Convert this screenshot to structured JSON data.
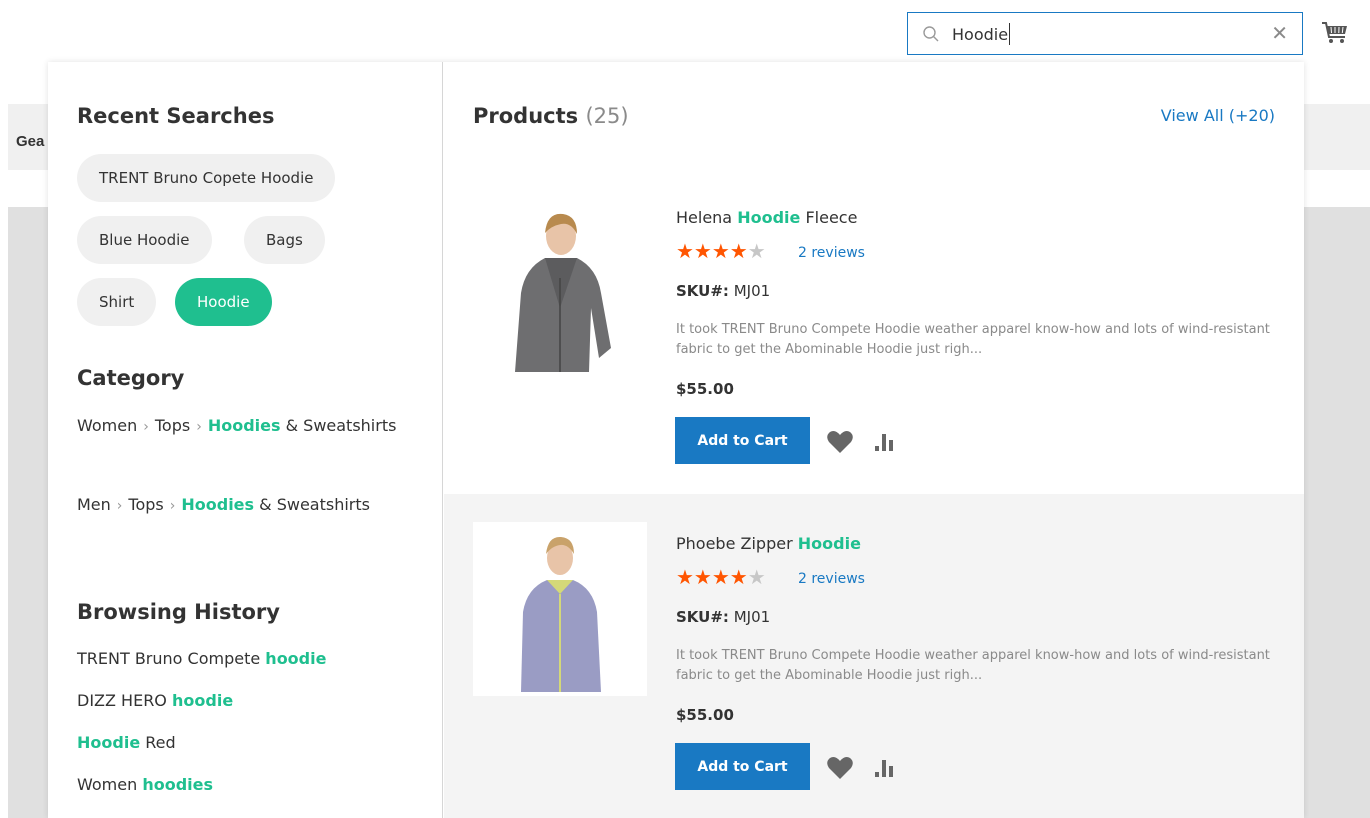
{
  "header": {
    "search": {
      "value": "Hoodie",
      "placeholder": ""
    },
    "icons": {
      "search": "search-icon",
      "clear": "close-icon",
      "cart": "cart-icon"
    }
  },
  "background": {
    "nav_label": "Gea"
  },
  "recent_searches": {
    "title": "Recent Searches",
    "items": [
      {
        "label": "TRENT Bruno Copete Hoodie",
        "active": false
      },
      {
        "label": "Blue Hoodie",
        "active": false
      },
      {
        "label": "Bags",
        "active": false
      },
      {
        "label": "Shirt",
        "active": false
      },
      {
        "label": "Hoodie",
        "active": true
      }
    ]
  },
  "category": {
    "title": "Category",
    "paths": [
      {
        "parts": [
          "Women",
          "Tops"
        ],
        "highlight": "Hoodies",
        "rest": "& Sweatshirts"
      },
      {
        "parts": [
          "Men",
          "Tops"
        ],
        "highlight": "Hoodies",
        "rest": "& Sweatshirts"
      }
    ]
  },
  "browsing_history": {
    "title": "Browsing History",
    "items": [
      {
        "before": "TRENT Bruno Compete",
        "highlight": "hoodie",
        "after": ""
      },
      {
        "before": "DIZZ HERO",
        "highlight": "hoodie",
        "after": ""
      },
      {
        "before": "",
        "highlight": "Hoodie",
        "after": "Red"
      },
      {
        "before": "Women",
        "highlight": "hoodies",
        "after": ""
      }
    ]
  },
  "products": {
    "title": "Products",
    "count": "(25)",
    "view_all": "View All (+20)",
    "items": [
      {
        "name_before": "Helena",
        "name_highlight": "Hoodie",
        "name_after": "Fleece",
        "rating": 4,
        "rating_max": 5,
        "reviews": "2 reviews",
        "sku_label": "SKU#:",
        "sku": "MJ01",
        "description": "It took TRENT Bruno Compete Hoodie weather apparel know-how and lots of wind-resistant fabric to get the Abominable Hoodie just righ...",
        "price": "$55.00",
        "add_to_cart": "Add to Cart",
        "image_color": "#6e6e70"
      },
      {
        "name_before": "Phoebe Zipper",
        "name_highlight": "Hoodie",
        "name_after": "",
        "rating": 4,
        "rating_max": 5,
        "reviews": "2 reviews",
        "sku_label": "SKU#:",
        "sku": "MJ01",
        "description": "It took TRENT Bruno Compete Hoodie weather apparel know-how and lots of wind-resistant fabric to get the Abominable Hoodie just righ...",
        "price": "$55.00",
        "add_to_cart": "Add to Cart",
        "image_color": "#9a9cc4"
      }
    ]
  },
  "colors": {
    "accent": "#1fbf8f",
    "link": "#1979c3",
    "star": "#ff5501",
    "button": "#1979c3"
  }
}
